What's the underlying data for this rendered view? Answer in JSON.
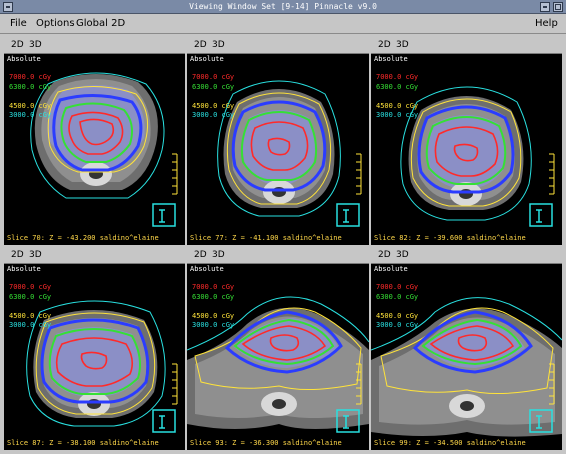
{
  "window": {
    "title": "Viewing Window Set [9-14]  Pinnacle v9.0"
  },
  "menu": {
    "file": "File",
    "options": "Options",
    "global2d": "Global 2D",
    "help": "Help"
  },
  "toolbar": {
    "btn2d": "2D",
    "btn3d": "3D"
  },
  "view": {
    "mode": "Absolute"
  },
  "isodose_levels": [
    {
      "label": "7000.0 cGy",
      "color": "#ff2a2a"
    },
    {
      "label": "6300.0 cGy",
      "color": "#35e035"
    },
    {
      "label": "",
      "color": "#2b3cff"
    },
    {
      "label": "4500.0 cGy",
      "color": "#ffe33a"
    },
    {
      "label": "3000.0 cGy",
      "color": "#29e0e0"
    }
  ],
  "panels": [
    {
      "slice": "Slice 70: Z = -43.200 saldino^elaine"
    },
    {
      "slice": "Slice 77: Z = -41.100 saldino^elaine"
    },
    {
      "slice": "Slice 82: Z = -39.600 saldino^elaine"
    },
    {
      "slice": "Slice 87: Z = -38.100 saldino^elaine"
    },
    {
      "slice": "Slice 93: Z = -36.300 saldino^elaine"
    },
    {
      "slice": "Slice 99: Z = -34.500 saldino^elaine"
    }
  ]
}
